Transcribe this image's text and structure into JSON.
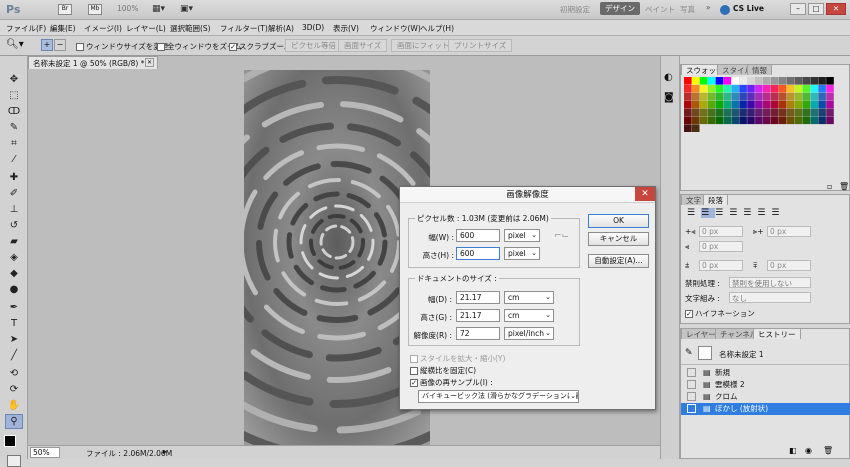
{
  "app": {
    "logo": "Ps",
    "zoom_value": "100%",
    "workspace_buttons": [
      "初期設定",
      "デザイン",
      "ペイント",
      "写真"
    ],
    "active_workspace": "デザイン",
    "cs_live": "CS Live"
  },
  "menu": [
    "ファイル(F)",
    "編集(E)",
    "イメージ(I)",
    "レイヤー(L)",
    "選択範囲(S)",
    "フィルター(T)",
    "解析(A)",
    "3D(D)",
    "表示(V)",
    "ウィンドウ(W)",
    "ヘルプ(H)"
  ],
  "options_bar": {
    "resize_windows": "ウィンドウサイズを変更",
    "all_windows": "全ウィンドウをズーム",
    "scrubby_zoom": "スクラブズーム",
    "actual_pixels": "ピクセル等倍",
    "fit_screen": "画面サイズ",
    "fill_screen": "画面にフィット",
    "print_size": "プリントサイズ"
  },
  "document": {
    "tab_title": "名称未設定 1 @ 50% (RGB/8) *",
    "status_zoom": "50%",
    "status_file": "ファイル : 2.06M/2.06M"
  },
  "dialog": {
    "title": "画像解像度",
    "pixel_dimensions_label": "ピクセル数 : 1.03M (変更前は 2.06M)",
    "width_label": "幅(W) :",
    "width_value": "600",
    "width_unit": "pixel",
    "height_label": "高さ(H) :",
    "height_value": "600",
    "height_unit": "pixel",
    "document_size_label": "ドキュメントのサイズ :",
    "doc_width_label": "幅(D) :",
    "doc_width_value": "21.17",
    "doc_width_unit": "cm",
    "doc_height_label": "高さ(G) :",
    "doc_height_value": "21.17",
    "doc_height_unit": "cm",
    "resolution_label": "解像度(R) :",
    "resolution_value": "72",
    "resolution_unit": "pixel/inch",
    "scale_styles": "スタイルを拡大・縮小(Y)",
    "constrain": "縦横比を固定(C)",
    "resample": "画像の再サンプル(I) :",
    "resample_method": "バイキュービック法 (滑らかなグラデーションに最適)",
    "ok": "OK",
    "cancel": "キャンセル",
    "auto": "自動設定(A)..."
  },
  "panels": {
    "swatch_tabs": [
      "スウォッチ",
      "スタイル",
      "情報"
    ],
    "para_tabs": [
      "文字",
      "段落"
    ],
    "indent_value": "0 px",
    "kinsoku_label": "禁則処理 :",
    "kinsoku_value": "禁則を使用しない",
    "mojikumi_label": "文字組み :",
    "mojikumi_value": "なし",
    "hyphenation": "ハイフネーション",
    "history_tabs": [
      "レイヤー",
      "チャンネル",
      "ヒストリー"
    ],
    "history_snapshot": "名称未設定 1",
    "history_items": [
      "新規",
      "雲模様 2",
      "クロム",
      "ぼかし (放射状)"
    ]
  },
  "colors": {
    "accent": "#3c86e0",
    "close_red": "#c7463e",
    "history_selected": "#2f7de0"
  }
}
